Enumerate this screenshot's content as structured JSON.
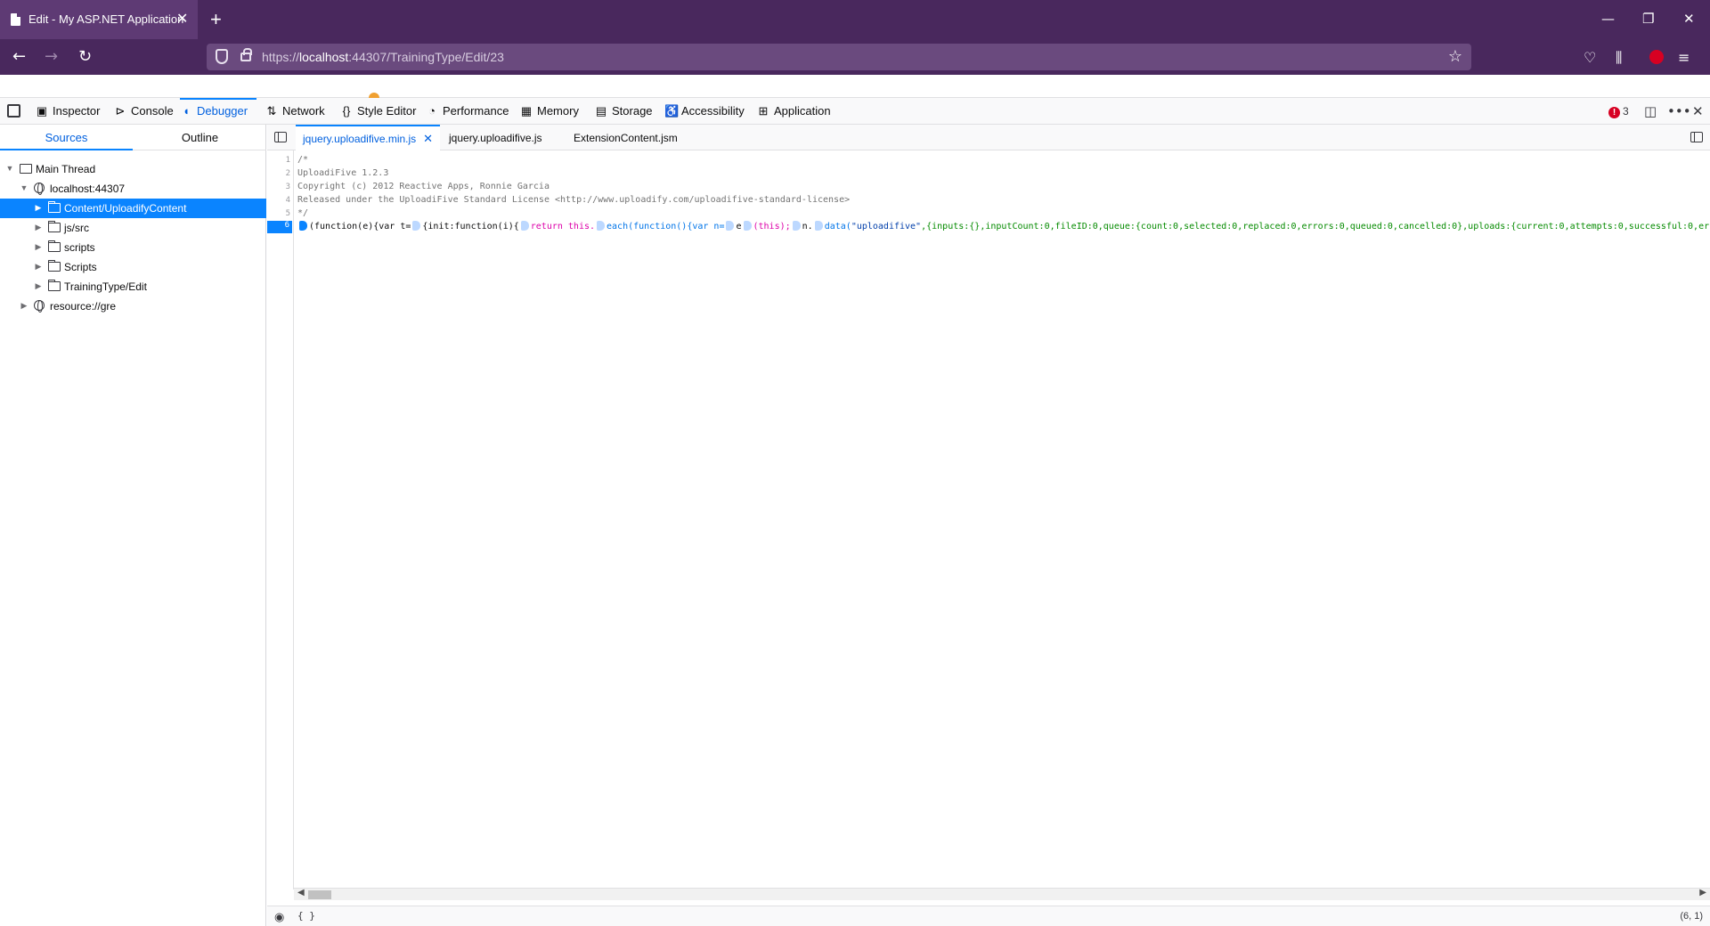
{
  "browser": {
    "tab_title": "Edit - My ASP.NET Application",
    "url_prefix": "https://",
    "url_host": "localhost",
    "url_rest": ":44307/TrainingType/Edit/23"
  },
  "devtools": {
    "tabs": [
      {
        "label": "Inspector",
        "icon": "inspector-icon"
      },
      {
        "label": "Console",
        "icon": "console-icon"
      },
      {
        "label": "Debugger",
        "icon": "debugger-icon"
      },
      {
        "label": "Network",
        "icon": "network-icon"
      },
      {
        "label": "Style Editor",
        "icon": "style-editor-icon"
      },
      {
        "label": "Performance",
        "icon": "performance-icon"
      },
      {
        "label": "Memory",
        "icon": "memory-icon"
      },
      {
        "label": "Storage",
        "icon": "storage-icon"
      },
      {
        "label": "Accessibility",
        "icon": "accessibility-icon"
      },
      {
        "label": "Application",
        "icon": "application-icon"
      }
    ],
    "active_tab": "Debugger",
    "error_count": "3"
  },
  "sources": {
    "tabs": [
      "Sources",
      "Outline"
    ],
    "tree": [
      {
        "label": "Main Thread",
        "icon": "window-icon"
      },
      {
        "label": "localhost:44307",
        "icon": "globe-icon"
      },
      {
        "label": "Content/UploadifyContent",
        "icon": "folder-icon",
        "selected": true
      },
      {
        "label": "js/src",
        "icon": "folder-icon"
      },
      {
        "label": "scripts",
        "icon": "folder-icon"
      },
      {
        "label": "Scripts",
        "icon": "folder-icon"
      },
      {
        "label": "TrainingType/Edit",
        "icon": "folder-icon"
      },
      {
        "label": "resource://gre",
        "icon": "globe-icon"
      }
    ]
  },
  "editor": {
    "tabs": [
      "jquery.uploadifive.min.js",
      "jquery.uploadifive.js",
      "ExtensionContent.jsm"
    ],
    "line_numbers": [
      "1",
      "2",
      "3",
      "4",
      "5",
      "6"
    ],
    "lines": [
      "/*",
      "UploadiFive 1.2.3",
      "Copyright (c) 2012 Reactive Apps, Ronnie Garcia",
      "Released under the UploadiFive Standard License <http://www.uploadify.com/uploadifive-standard-license>",
      "*/"
    ],
    "line6": {
      "t1": "(function(e){var t=",
      "t2": "{init:function(i){",
      "t3": "return this.",
      "t4": "each(function(){var n=",
      "t5": "e",
      "t6": "(this);",
      "t7": "n.",
      "t8": "data(",
      "t9": "\"uploadifive\"",
      "t10": ",{inputs:{},inputCount:0,fileID:0,queue:{count:0,selected:0,replaced:0,errors:0,queued:0,cancelled:0},uploads:{current:0,attempts:0,successful:0,err"
    }
  },
  "footer": {
    "braces": "{ }",
    "cursor_position": "(6, 1)"
  }
}
